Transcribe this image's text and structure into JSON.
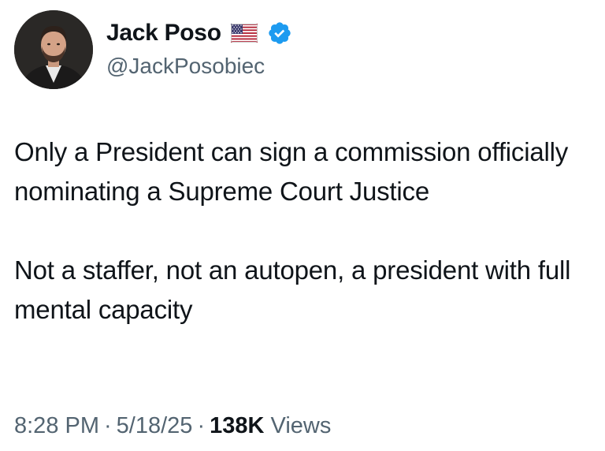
{
  "author": {
    "display_name": "Jack Poso",
    "handle": "@JackPosobiec",
    "flag_icon": "us-flag-icon",
    "verified_icon": "verified-badge-icon",
    "verified_color": "#1d9bf0"
  },
  "tweet": {
    "paragraphs": [
      "Only a President can sign a commission officially nominating a Supreme Court Justice",
      "Not a staffer, not an autopen, a president with full mental capacity"
    ]
  },
  "meta": {
    "time": "8:28 PM",
    "date": "5/18/25",
    "separator": "·",
    "views_count": "138K",
    "views_label": "Views"
  },
  "colors": {
    "text_primary": "#0f1419",
    "text_secondary": "#536471",
    "background": "#ffffff"
  }
}
